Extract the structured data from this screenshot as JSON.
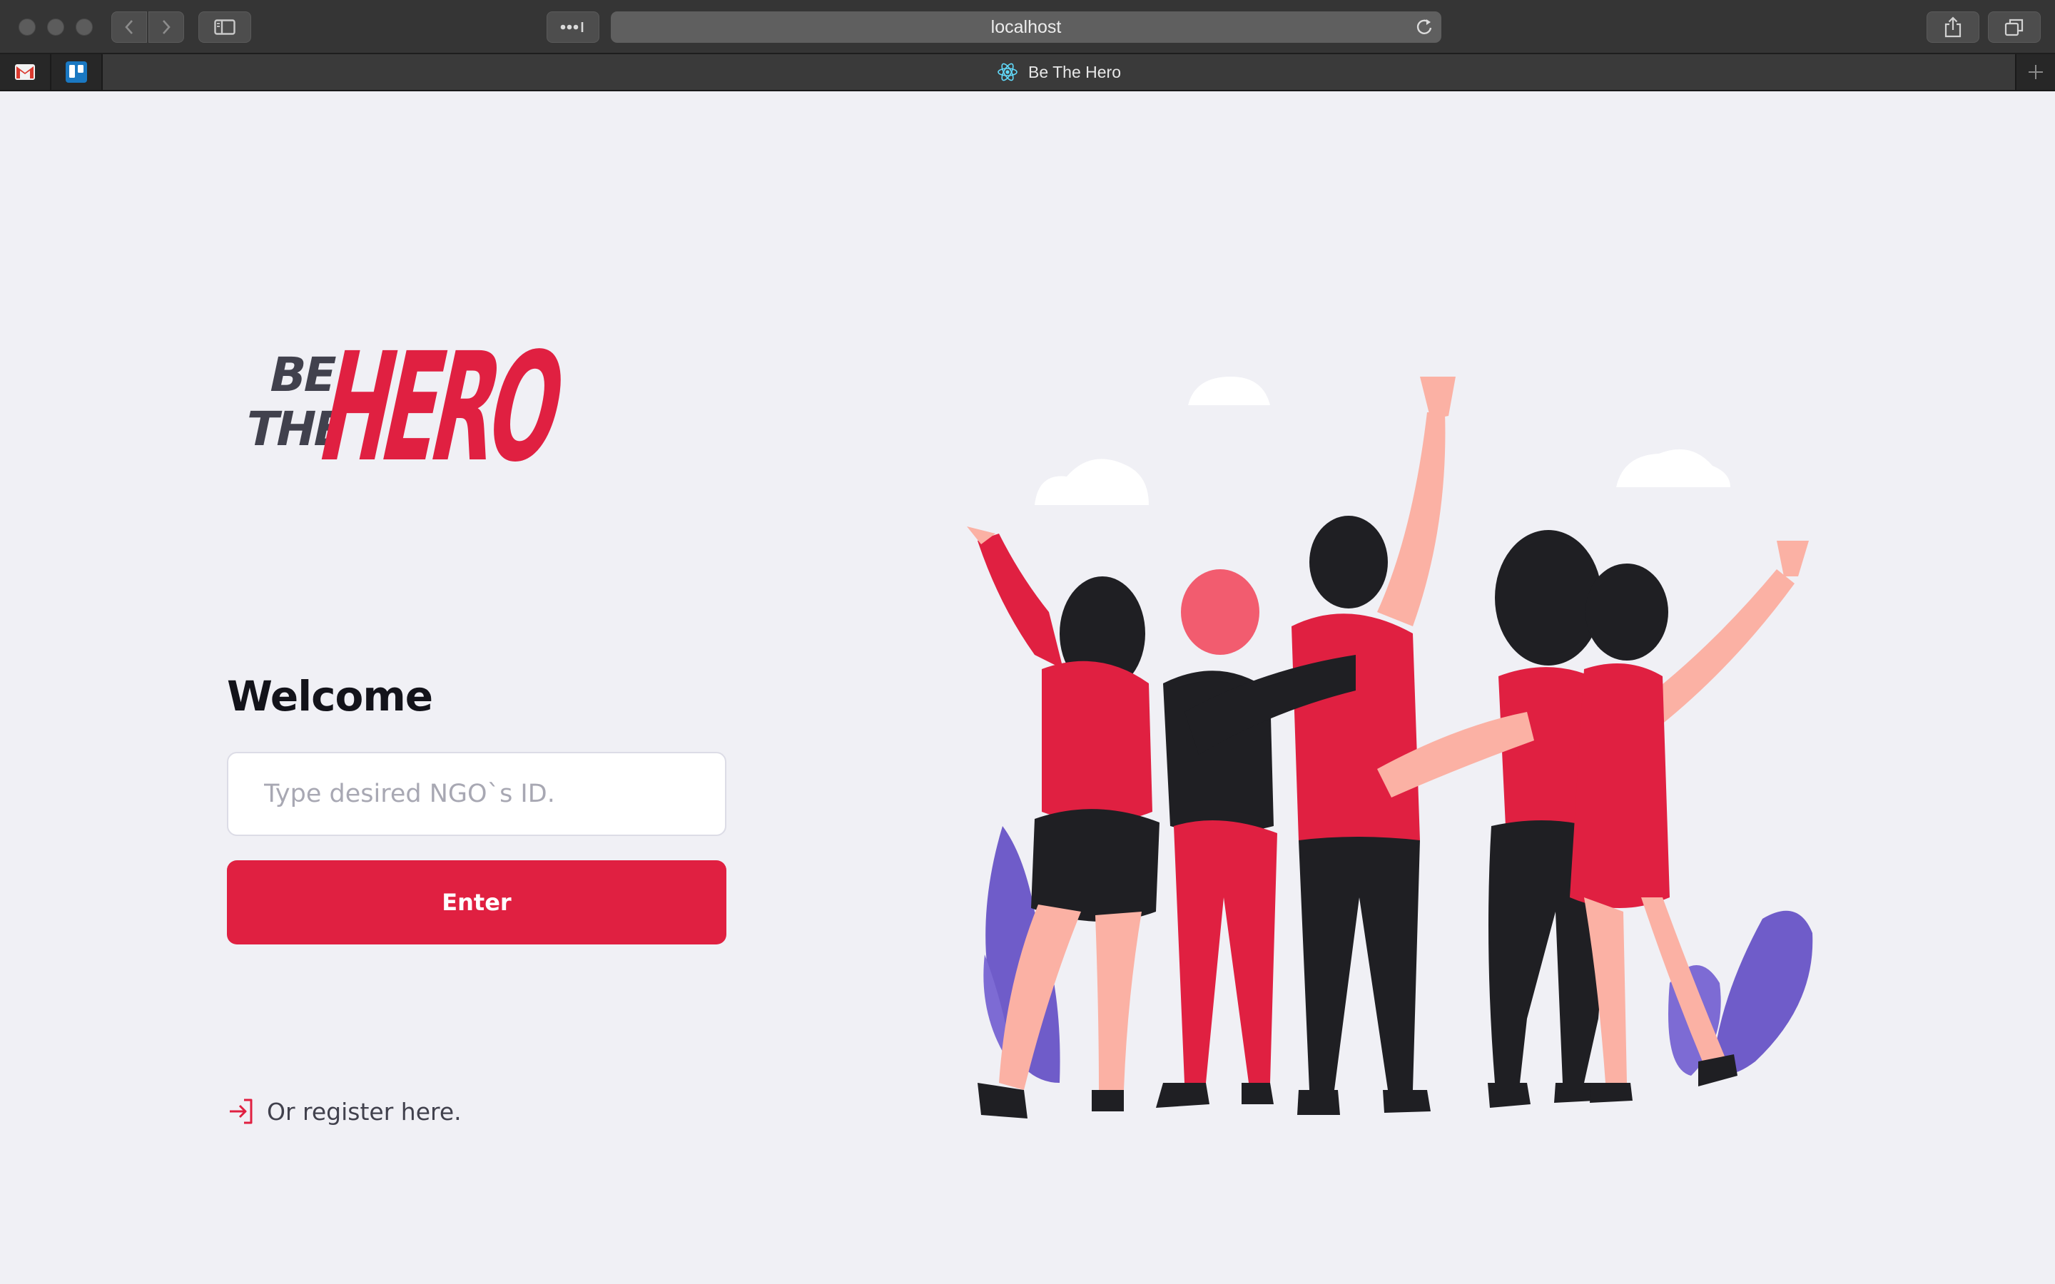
{
  "browser": {
    "url": "localhost",
    "tab_title": "Be The Hero"
  },
  "logo": {
    "line1": "BE",
    "line2": "THE",
    "line3": "HERO"
  },
  "login": {
    "heading": "Welcome",
    "id_placeholder": "Type desired NGO`s ID.",
    "submit_label": "Enter",
    "register_label": "Or register here."
  },
  "colors": {
    "brand_red": "#e02041",
    "background": "#f0f0f5",
    "heading": "#13131a",
    "text": "#41414d"
  },
  "icons": [
    "gmail-icon",
    "trello-icon",
    "react-icon",
    "log-in-icon",
    "share-icon",
    "tabs-overview-icon",
    "reload-icon",
    "reader-icon",
    "sidebar-icon"
  ]
}
